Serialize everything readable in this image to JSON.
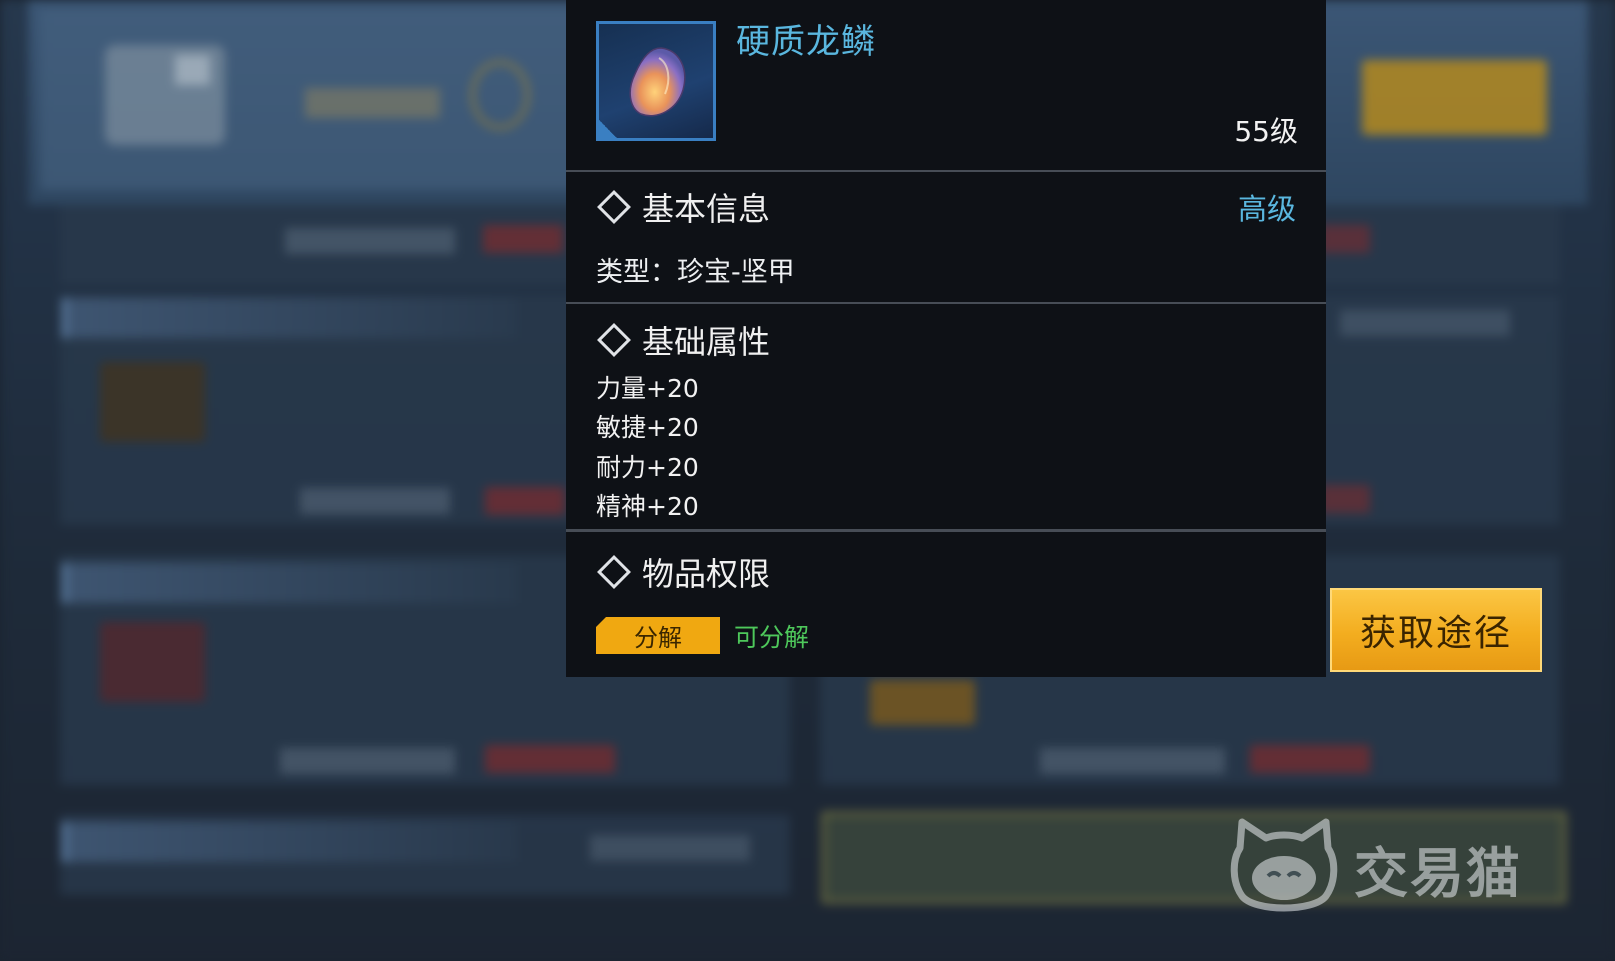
{
  "item": {
    "name": "硬质龙鳞",
    "level": "55级",
    "icon": "dragon-scale-icon"
  },
  "basic_info": {
    "title": "基本信息",
    "grade": "高级",
    "type_line": "类型：珍宝-坚甲"
  },
  "base_attributes": {
    "title": "基础属性",
    "items": [
      "力量+20",
      "敏捷+20",
      "耐力+20",
      "精神+20"
    ]
  },
  "permissions": {
    "title": "物品权限",
    "tag": "分解",
    "status": "可分解"
  },
  "source_button": {
    "label": "获取途径"
  },
  "watermark": {
    "text": "交易猫",
    "icon": "cat-logo-icon"
  },
  "colors": {
    "item_name": "#5ab7df",
    "grade": "#5ab7df",
    "tag": "#f0a811",
    "status_ok": "#4ec85b",
    "button": "#f3ad1f"
  }
}
